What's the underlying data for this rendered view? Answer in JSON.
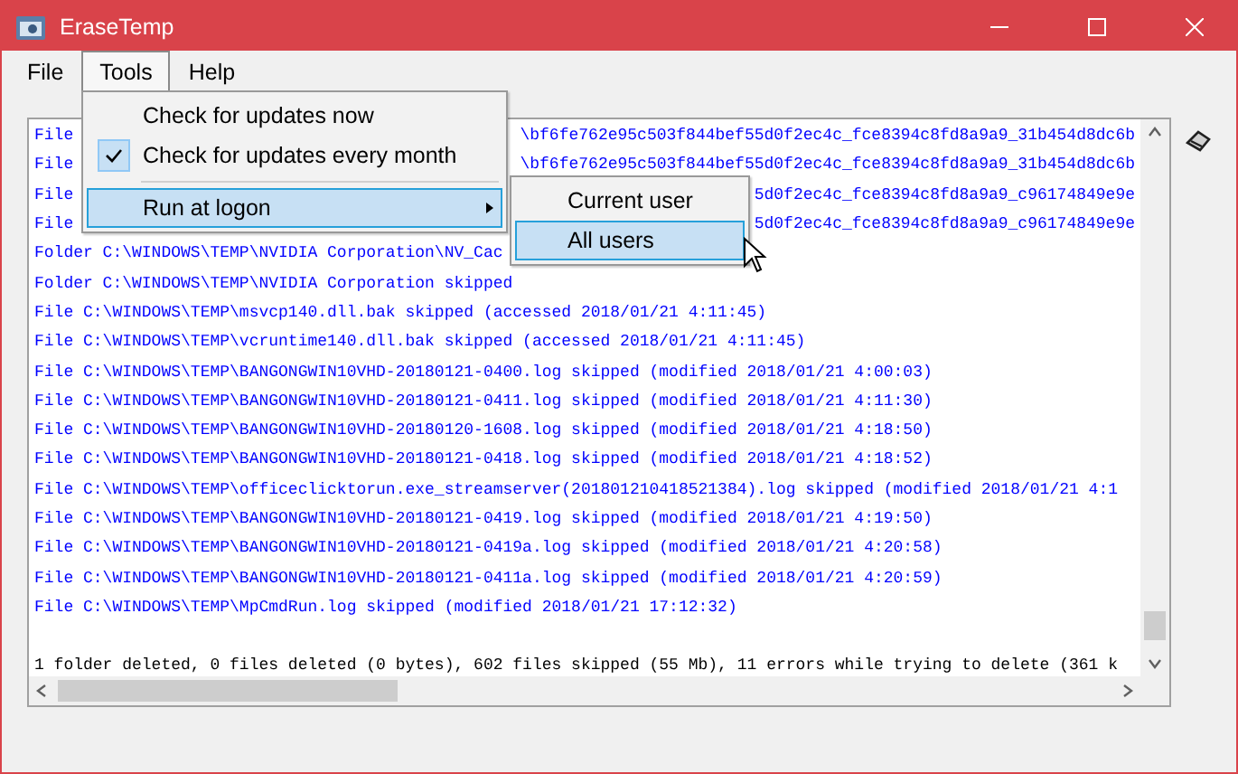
{
  "window": {
    "title": "EraseTemp"
  },
  "menu_bar": [
    {
      "label": "File",
      "selected": false
    },
    {
      "label": "Tools",
      "selected": true
    },
    {
      "label": "Help",
      "selected": false
    }
  ],
  "tools_menu": [
    {
      "kind": "item",
      "label": "Check for updates now",
      "checked": false,
      "selected": false
    },
    {
      "kind": "item",
      "label": "Check for updates every month",
      "checked": true,
      "selected": false
    },
    {
      "kind": "separator"
    },
    {
      "kind": "submenu",
      "label": "Run at logon",
      "selected": true
    }
  ],
  "submenu": [
    {
      "label": "Current user",
      "selected": false
    },
    {
      "label": "All users",
      "selected": true
    }
  ],
  "log": [
    {
      "kind": "entry",
      "lead": "File",
      "tail": "\\bf6fe762e95c503f844bef55d0f2ec4c_fce8394c8fd8a9a9_31b454d8dc6b"
    },
    {
      "kind": "entry",
      "lead": "File",
      "tail": "\\bf6fe762e95c503f844bef55d0f2ec4c_fce8394c8fd8a9a9_31b454d8dc6b"
    },
    {
      "kind": "entry",
      "lead": "File",
      "tail": "5d0f2ec4c_fce8394c8fd8a9a9_c96174849e9e"
    },
    {
      "kind": "entry",
      "lead": "File",
      "tail": "5d0f2ec4c_fce8394c8fd8a9a9_c96174849e9e"
    },
    {
      "kind": "entry",
      "lead": "Folder C:\\WINDOWS\\TEMP\\NVIDIA Corporation\\NV_Cac"
    },
    {
      "kind": "entry",
      "lead": "Folder C:\\WINDOWS\\TEMP\\NVIDIA Corporation skipped"
    },
    {
      "kind": "entry",
      "lead": "File C:\\WINDOWS\\TEMP\\msvcp140.dll.bak skipped (accessed 2018/01/21 4:11:45)"
    },
    {
      "kind": "entry",
      "lead": "File C:\\WINDOWS\\TEMP\\vcruntime140.dll.bak skipped (accessed 2018/01/21 4:11:45)"
    },
    {
      "kind": "entry",
      "lead": "File C:\\WINDOWS\\TEMP\\BANGONGWIN10VHD-20180121-0400.log skipped (modified 2018/01/21 4:00:03)"
    },
    {
      "kind": "entry",
      "lead": "File C:\\WINDOWS\\TEMP\\BANGONGWIN10VHD-20180121-0411.log skipped (modified 2018/01/21 4:11:30)"
    },
    {
      "kind": "entry",
      "lead": "File C:\\WINDOWS\\TEMP\\BANGONGWIN10VHD-20180120-1608.log skipped (modified 2018/01/21 4:18:50)"
    },
    {
      "kind": "entry",
      "lead": "File C:\\WINDOWS\\TEMP\\BANGONGWIN10VHD-20180121-0418.log skipped (modified 2018/01/21 4:18:52)"
    },
    {
      "kind": "entry",
      "lead": "File C:\\WINDOWS\\TEMP\\officeclicktorun.exe_streamserver(201801210418521384).log skipped (modified 2018/01/21 4:1"
    },
    {
      "kind": "entry",
      "lead": "File C:\\WINDOWS\\TEMP\\BANGONGWIN10VHD-20180121-0419.log skipped (modified 2018/01/21 4:19:50)"
    },
    {
      "kind": "entry",
      "lead": "File C:\\WINDOWS\\TEMP\\BANGONGWIN10VHD-20180121-0419a.log skipped (modified 2018/01/21 4:20:58)"
    },
    {
      "kind": "entry",
      "lead": "File C:\\WINDOWS\\TEMP\\BANGONGWIN10VHD-20180121-0411a.log skipped (modified 2018/01/21 4:20:59)"
    },
    {
      "kind": "entry",
      "lead": "File C:\\WINDOWS\\TEMP\\MpCmdRun.log skipped (modified 2018/01/21 17:12:32)"
    },
    {
      "kind": "blank"
    },
    {
      "kind": "summary",
      "lead": "1 folder deleted, 0 files deleted (0 bytes), 602 files skipped (55 Mb), 11 errors while trying to delete (361 k"
    }
  ]
}
